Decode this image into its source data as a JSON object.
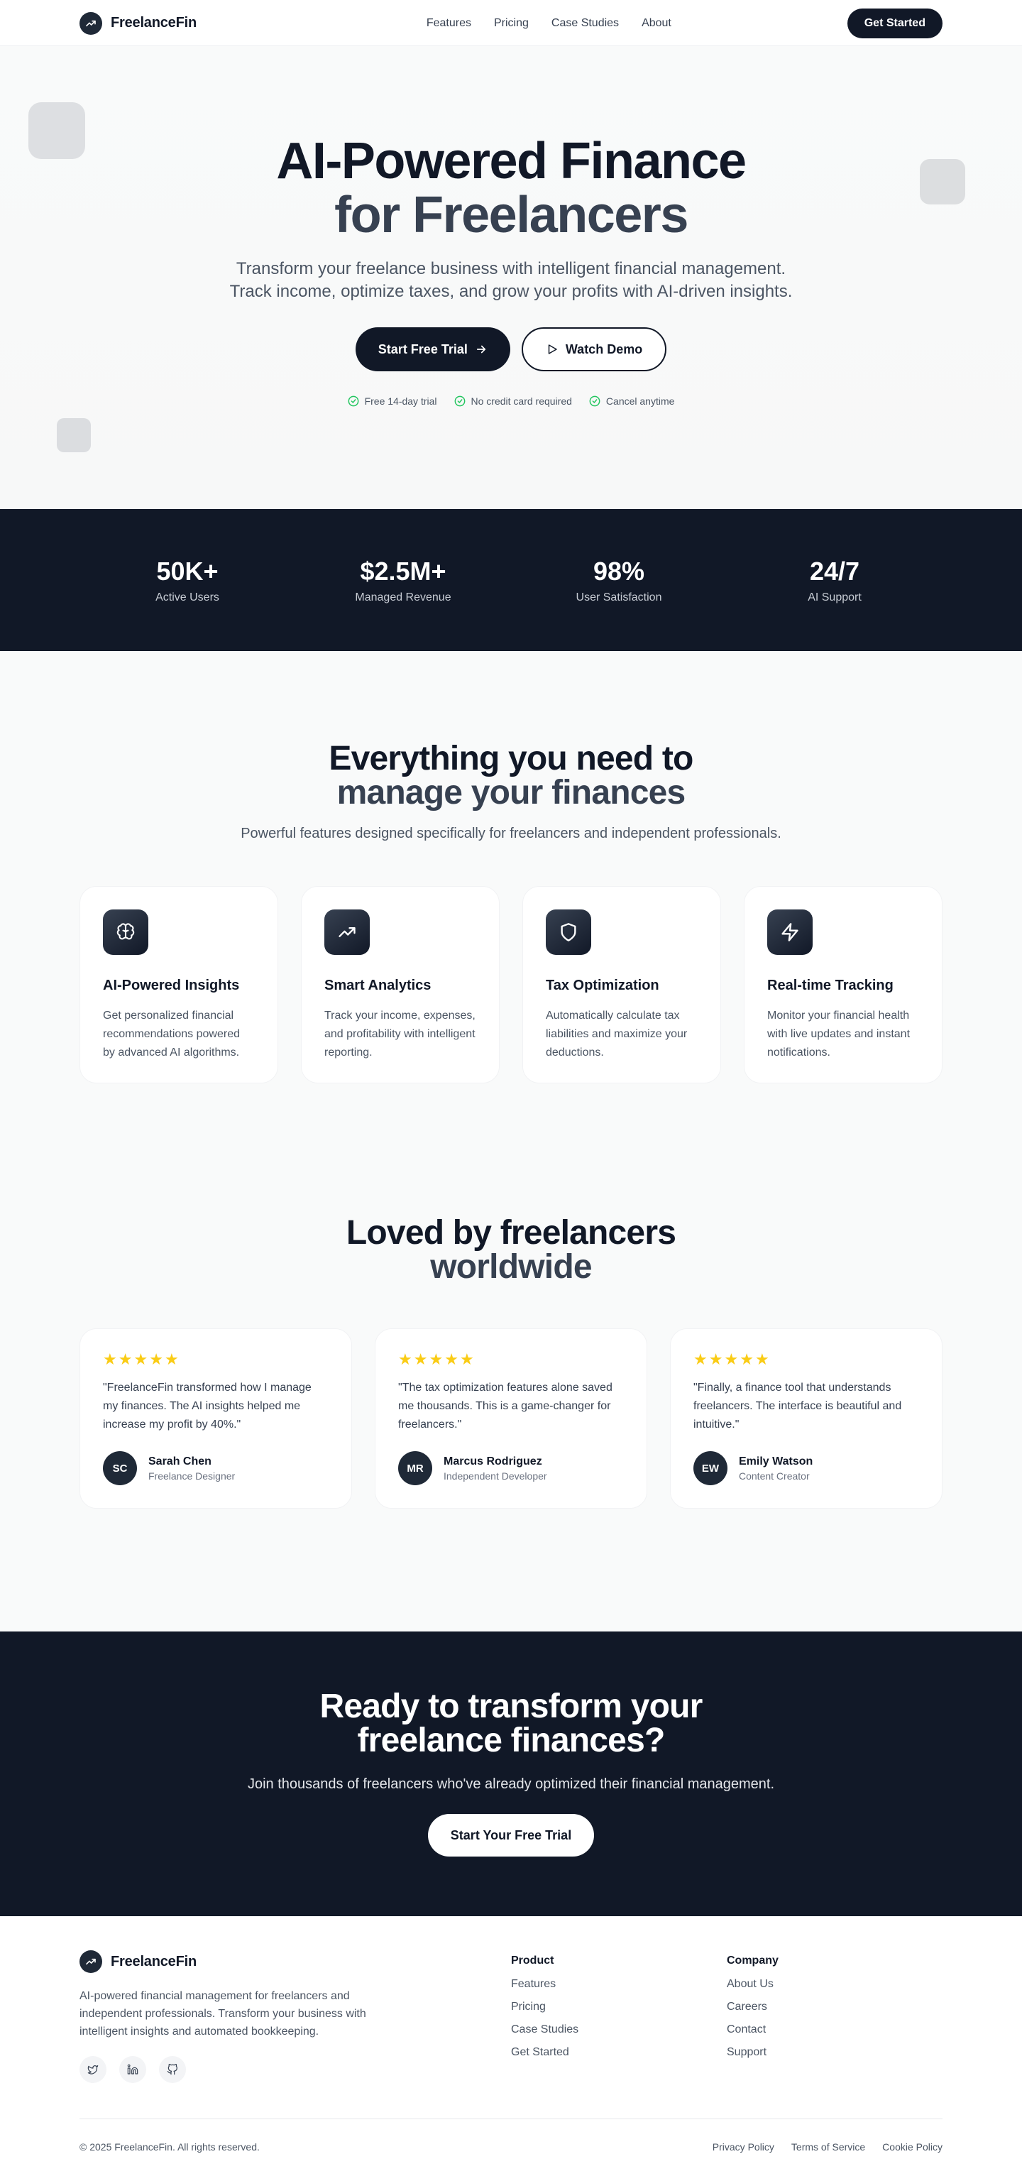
{
  "brand": {
    "name": "FreelanceFin",
    "logo_icon": "trending-up-icon"
  },
  "nav": {
    "links": [
      "Features",
      "Pricing",
      "Case Studies",
      "About"
    ],
    "cta": "Get Started"
  },
  "hero": {
    "title_line1": "AI-Powered Finance",
    "title_line2": "for Freelancers",
    "subtitle": "Transform your freelance business with intelligent financial management. Track income, optimize taxes, and grow your profits with AI-driven insights.",
    "primary_cta": "Start Free Trial",
    "secondary_cta": "Watch Demo",
    "checks": [
      "Free 14-day trial",
      "No credit card required",
      "Cancel anytime"
    ]
  },
  "stats": [
    {
      "value": "50K+",
      "label": "Active Users"
    },
    {
      "value": "$2.5M+",
      "label": "Managed Revenue"
    },
    {
      "value": "98%",
      "label": "User Satisfaction"
    },
    {
      "value": "24/7",
      "label": "AI Support"
    }
  ],
  "features": {
    "title_line1": "Everything you need to",
    "title_line2": "manage your finances",
    "subtitle": "Powerful features designed specifically for freelancers and independent professionals.",
    "items": [
      {
        "icon": "brain-icon",
        "title": "AI-Powered Insights",
        "desc": "Get personalized financial recommendations powered by advanced AI algorithms."
      },
      {
        "icon": "trending-up-icon",
        "title": "Smart Analytics",
        "desc": "Track your income, expenses, and profitability with intelligent reporting."
      },
      {
        "icon": "shield-icon",
        "title": "Tax Optimization",
        "desc": "Automatically calculate tax liabilities and maximize your deductions."
      },
      {
        "icon": "zap-icon",
        "title": "Real-time Tracking",
        "desc": "Monitor your financial health with live updates and instant notifications."
      }
    ]
  },
  "testimonials": {
    "title_line1": "Loved by freelancers",
    "title_line2": "worldwide",
    "rating": 5,
    "items": [
      {
        "quote": "\"FreelanceFin transformed how I manage my finances. The AI insights helped me increase my profit by 40%.\"",
        "initials": "SC",
        "name": "Sarah Chen",
        "role": "Freelance Designer"
      },
      {
        "quote": "\"The tax optimization features alone saved me thousands. This is a game-changer for freelancers.\"",
        "initials": "MR",
        "name": "Marcus Rodriguez",
        "role": "Independent Developer"
      },
      {
        "quote": "\"Finally, a finance tool that understands freelancers. The interface is beautiful and intuitive.\"",
        "initials": "EW",
        "name": "Emily Watson",
        "role": "Content Creator"
      }
    ]
  },
  "cta": {
    "title_line1": "Ready to transform your",
    "title_line2": "freelance finances?",
    "subtitle": "Join thousands of freelancers who've already optimized their financial management.",
    "button": "Start Your Free Trial"
  },
  "footer": {
    "description": "AI-powered financial management for freelancers and independent professionals. Transform your business with intelligent insights and automated bookkeeping.",
    "socials": [
      "twitter-icon",
      "linkedin-icon",
      "github-icon"
    ],
    "product": {
      "heading": "Product",
      "links": [
        "Features",
        "Pricing",
        "Case Studies",
        "Get Started"
      ]
    },
    "company": {
      "heading": "Company",
      "links": [
        "About Us",
        "Careers",
        "Contact",
        "Support"
      ]
    },
    "copyright": "© 2025 FreelanceFin. All rights reserved.",
    "legal": [
      "Privacy Policy",
      "Terms of Service",
      "Cookie Policy"
    ]
  },
  "colors": {
    "ink": "#111827",
    "ink_soft": "#374151",
    "star": "#facc15",
    "check": "#22c55e"
  }
}
